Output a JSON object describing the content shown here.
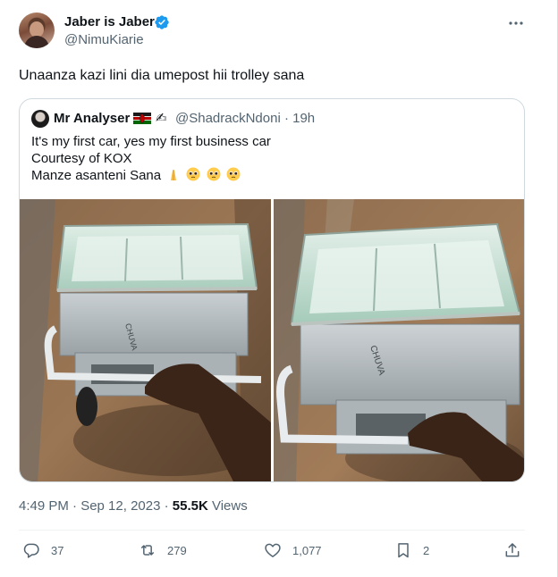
{
  "author": {
    "display_name": "Jaber is Jaber",
    "handle": "@NimuKiarie",
    "verified": true
  },
  "tweet_text": "Unaanza kazi lini dia umepost hii trolley sana",
  "quoted_tweet": {
    "display_name": "Mr Analyser",
    "name_emojis": [
      "kenya-flag-icon",
      "writing-hand-icon"
    ],
    "handle_time": "@ShadrackNdoni · 19h",
    "lines": [
      "It's my first car, yes my first business car",
      "Courtesy of KOX",
      "Manze asanteni Sana"
    ],
    "line3_emojis": [
      "folded-hands-icon",
      "pleading-face-icon",
      "pleading-face-icon",
      "pleading-face-icon"
    ],
    "media": [
      "trolley-photo-1",
      "trolley-photo-2"
    ]
  },
  "timestamp": {
    "time_date": "4:49 PM · Sep 12, 2023 · ",
    "views_count": "55.5K",
    "views_label": " Views"
  },
  "actions": {
    "replies": "37",
    "retweets": "279",
    "likes": "1,077",
    "bookmarks": "2"
  },
  "colors": {
    "verified_blue": "#1d9bf0",
    "secondary_text": "#536471",
    "primary_text": "#0f1419",
    "border": "#cfd9de"
  }
}
